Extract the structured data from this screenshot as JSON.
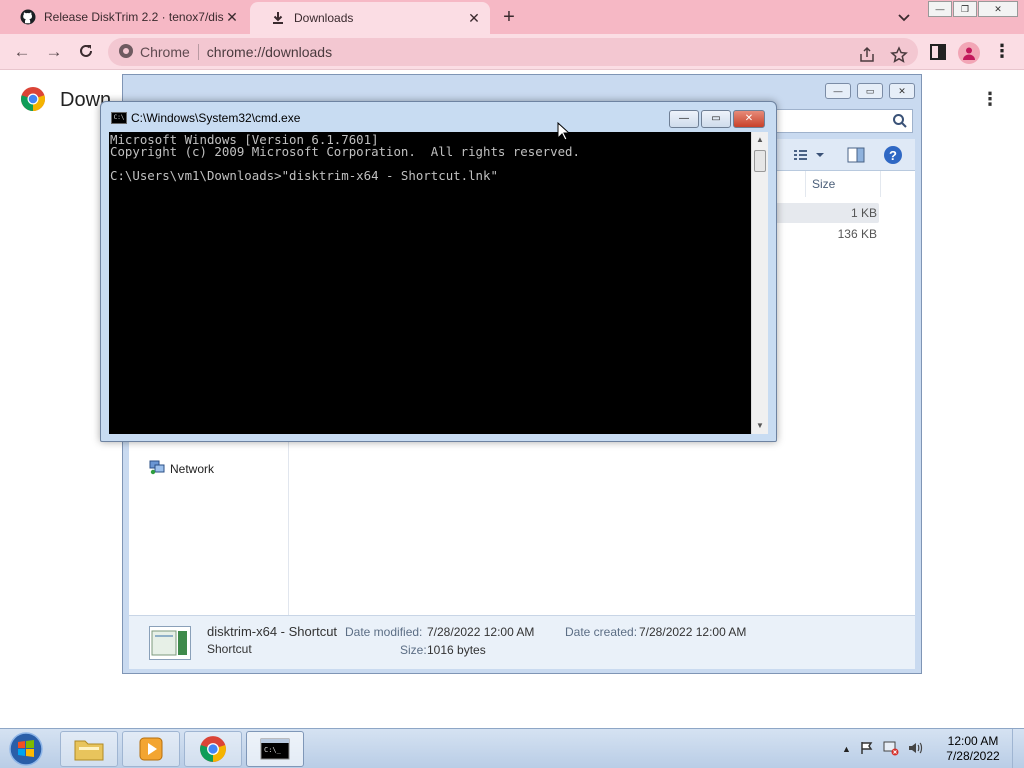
{
  "chrome": {
    "tabs": [
      {
        "title": "Release DiskTrim 2.2 · tenox7/dis"
      },
      {
        "title": "Downloads"
      }
    ],
    "window_controls": {
      "minimize": "—",
      "restore": "❐",
      "close": "✕"
    },
    "omnibox": {
      "site_label": "Chrome",
      "url": "chrome://downloads"
    },
    "page_title": "Down"
  },
  "explorer": {
    "controls": {
      "minimize": "—",
      "maximize": "▭",
      "close": "✕"
    },
    "column_size": "Size",
    "rows": [
      {
        "size": "1 KB"
      },
      {
        "size": "136 KB"
      }
    ],
    "nav_network": "Network",
    "details": {
      "name": "disktrim-x64 - Shortcut",
      "type": "Shortcut",
      "date_modified_label": "Date modified:",
      "date_modified": "7/28/2022 12:00 AM",
      "date_created_label": "Date created:",
      "date_created": "7/28/2022 12:00 AM",
      "size_label": "Size:",
      "size": "1016 bytes"
    }
  },
  "cmd": {
    "title": "C:\\Windows\\System32\\cmd.exe",
    "controls": {
      "minimize": "—",
      "maximize": "▭",
      "close": "✕"
    },
    "console_lines": "Microsoft Windows [Version 6.1.7601]\nCopyright (c) 2009 Microsoft Corporation.  All rights reserved.\n\nC:\\Users\\vm1\\Downloads>\"disktrim-x64 - Shortcut.lnk\""
  },
  "taskbar": {
    "clock_time": "12:00 AM",
    "clock_date": "7/28/2022",
    "tray_arrow": "▲"
  },
  "colors": {
    "chrome_tabbar": "#f6b8c5",
    "chrome_toolbar": "#fbdde4",
    "cmd_background": "#000000",
    "cmd_text": "#c0c0c0"
  }
}
